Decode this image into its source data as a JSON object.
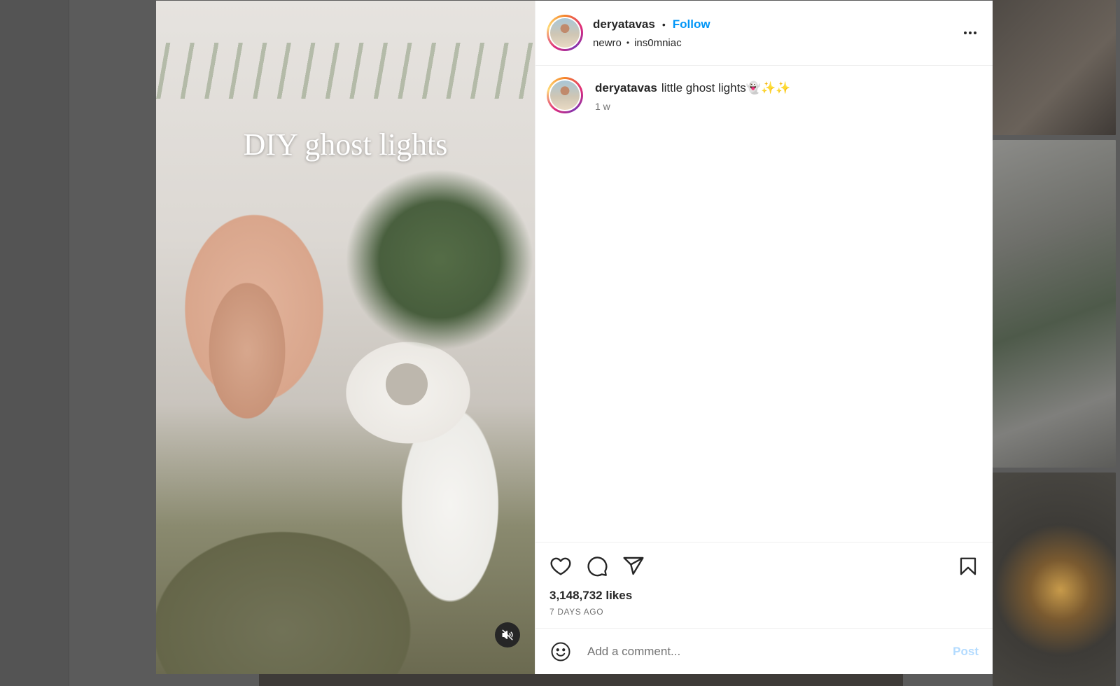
{
  "post": {
    "overlay_text": "DIY ghost lights",
    "mute_icon": "speaker-muted-icon"
  },
  "header": {
    "username": "deryatavas",
    "dot": "•",
    "follow_label": "Follow",
    "audio_artist": "newro",
    "audio_sep": "•",
    "audio_track": "ins0mniac",
    "more_icon": "more-horizontal-icon"
  },
  "caption": {
    "username": "deryatavas",
    "text": "little ghost lights👻✨✨",
    "time": "1 w"
  },
  "actions": {
    "icons": [
      "heart-icon",
      "comment-icon",
      "share-icon",
      "bookmark-icon"
    ],
    "likes": "3,148,732 likes",
    "date": "7 DAYS AGO"
  },
  "comment_box": {
    "emoji_icon": "emoji-icon",
    "placeholder": "Add a comment...",
    "post_label": "Post"
  },
  "colors": {
    "link_blue": "#0095f6",
    "post_disabled": "#b3dbff",
    "secondary_text": "#737373"
  }
}
